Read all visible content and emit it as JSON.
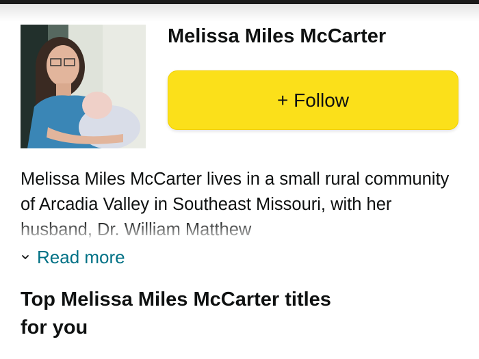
{
  "author": {
    "name": "Melissa Miles McCarter",
    "photo_icon": "author-photo"
  },
  "follow": {
    "label": "+ Follow",
    "color": "#fbe01a"
  },
  "bio": {
    "text": "Melissa Miles McCarter lives in a small rural community of Arcadia Valley in Southeast Missouri, with her husband, Dr. William Matthew",
    "read_more_label": "Read more",
    "read_more_icon": "chevron-down-icon",
    "link_color": "#007185"
  },
  "section": {
    "title": "Top Melissa Miles McCarter titles for you"
  }
}
